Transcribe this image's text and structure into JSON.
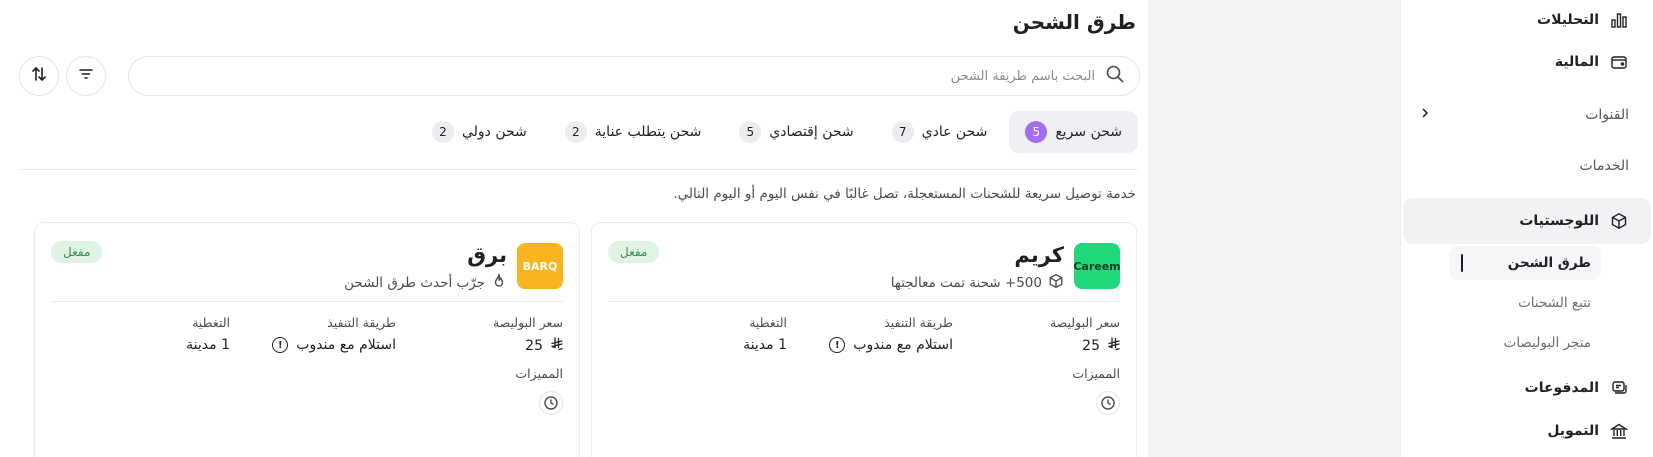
{
  "sidebar": {
    "analytics": "التحليلات",
    "finance": "المالية",
    "channels": "القنوات",
    "services": "الخدمات",
    "logistics": "اللوجستيات",
    "sub_items": [
      "طرق الشحن",
      "تتبع الشحنات",
      "متجر البوليصات"
    ],
    "payments": "المدفوعات",
    "funding": "التمويل"
  },
  "main": {
    "title": "طرق الشحن",
    "search_placeholder": "البحث باسم طريقة الشحن",
    "description": "خدمة توصيل سريعة للشحنات المستعجلة، تصل غالبًا في نفس اليوم أو اليوم التالي.",
    "tabs": [
      {
        "label": "شحن سريع",
        "count": "5"
      },
      {
        "label": "شحن عادي",
        "count": "7"
      },
      {
        "label": "شحن إقتصادي",
        "count": "5"
      },
      {
        "label": "شحن يتطلب عناية",
        "count": "2"
      },
      {
        "label": "شحن دولي",
        "count": "2"
      }
    ],
    "cards": [
      {
        "logo_text": "Careem",
        "logo_bg": "#1ed97a",
        "logo_color": "#0b3d24",
        "name": "كريم",
        "subtitle": "500+ شحنة تمت معالجتها",
        "status": "مفعل",
        "policy_label": "سعر البوليصة",
        "policy_value": "25",
        "method_label": "طريقة التنفيذ",
        "method_value": "استلام  مع  مندوب",
        "coverage_label": "التغطية",
        "coverage_value": "1 مدينة",
        "features_label": "المميزات"
      },
      {
        "logo_text": "BARQ",
        "logo_bg": "#f9b31c",
        "logo_color": "#ffffff",
        "name": "برق",
        "subtitle": "جرّب أحدث طرق الشحن",
        "status": "مفعل",
        "policy_label": "سعر البوليصة",
        "policy_value": "25",
        "method_label": "طريقة التنفيذ",
        "method_value": "استلام  مع  مندوب",
        "coverage_label": "التغطية",
        "coverage_value": "1 مدينة",
        "features_label": "المميزات"
      }
    ]
  },
  "colors": {
    "accent": "#a16ef5",
    "status_bg": "#dff3e3",
    "status_text": "#3a8f4e"
  }
}
